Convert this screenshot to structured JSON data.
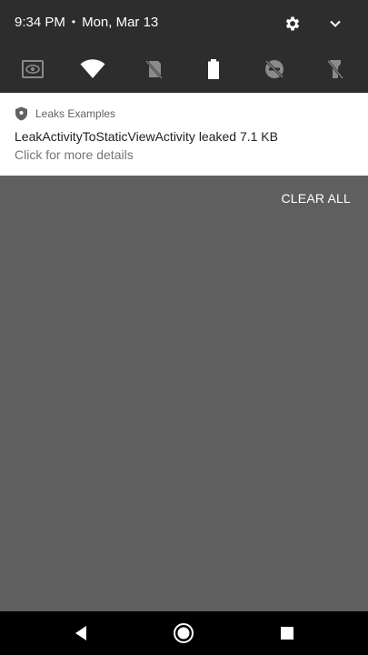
{
  "status": {
    "time": "9:34 PM",
    "separator": "•",
    "date": "Mon, Mar 13"
  },
  "icons": {
    "settings": "gear-icon",
    "expand": "chevron-down-icon",
    "tiles": [
      "screen-cast-icon",
      "wifi-icon",
      "mobile-data-off-icon",
      "battery-icon",
      "do-not-disturb-off-icon",
      "flashlight-off-icon"
    ],
    "app": "shield-icon",
    "nav": [
      "back-icon",
      "home-icon",
      "recents-icon"
    ]
  },
  "notification": {
    "app_name": "Leaks Examples",
    "title": "LeakActivityToStaticViewActivity leaked 7.1 KB",
    "text": "Click for more details"
  },
  "actions": {
    "clear_all": "CLEAR ALL"
  },
  "colors": {
    "header_bg": "#2d2d2d",
    "shade_bg": "#5f5f5f",
    "card_bg": "#ffffff",
    "nav_bg": "#000000"
  }
}
